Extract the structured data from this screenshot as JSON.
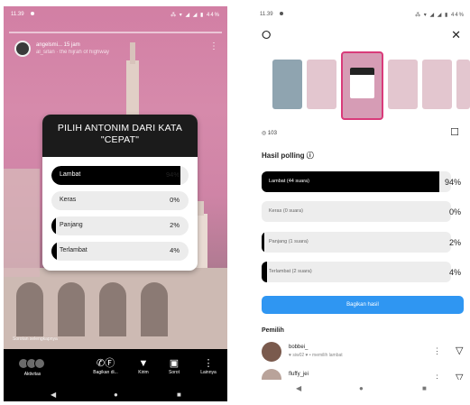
{
  "left": {
    "status": {
      "time": "11.39",
      "right": "⁂ ▾ ◢ ◢ ▮ 44%"
    },
    "author": {
      "name": "angelsmi...  15 jam",
      "sub": "al_sifan  ·  the hijrah of highway"
    },
    "poll": {
      "question": "PILIH ANTONIM DARI KATA \"CEPAT\"",
      "options": [
        {
          "label": "Lambat",
          "percent": "94%",
          "value": 94
        },
        {
          "label": "Keras",
          "percent": "0%",
          "value": 0
        },
        {
          "label": "Panjang",
          "percent": "2%",
          "value": 2
        },
        {
          "label": "Terlambat",
          "percent": "4%",
          "value": 4
        }
      ]
    },
    "footer_note": "Sorotan  selengkapnya",
    "bar": [
      {
        "label": "Aktivitas",
        "icon": "viewers-avatars"
      },
      {
        "label": "Bagikan di...",
        "icon": "whatsapp-facebook-icon"
      },
      {
        "label": "Kirim",
        "icon": "send-icon"
      },
      {
        "label": "Sorot",
        "icon": "highlight-icon"
      },
      {
        "label": "Lainnya",
        "icon": "more-icon"
      }
    ],
    "nav": {
      "back": "◀",
      "home": "●",
      "recent": "■"
    }
  },
  "right": {
    "status": {
      "time": "11.39",
      "right": "⁂ ▾ ◢ ◢ ▮ 44%"
    },
    "settings_icon": "⭘",
    "close_icon": "✕",
    "viewers": "◎ 103",
    "trash_icon": "☐",
    "results_title": "Hasil polling  ⓘ",
    "options": [
      {
        "label": "Lambat (44 suara)",
        "percent": "94%",
        "value": 94
      },
      {
        "label": "Keras (0 suara)",
        "percent": "0%",
        "value": 0
      },
      {
        "label": "Panjang (1 suara)",
        "percent": "2%",
        "value": 2
      },
      {
        "label": "Terlambat (2 suara)",
        "percent": "4%",
        "value": 4
      }
    ],
    "share_label": "Bagikan hasil",
    "voters_title": "Pemilih",
    "voters": [
      {
        "name": "bobbei_",
        "sub": "♥ siw02 ♥ • memilih lambat"
      },
      {
        "name": "fluffy_jei",
        "sub": ""
      }
    ],
    "nav": {
      "back": "◀",
      "home": "●",
      "recent": "■"
    }
  },
  "colors": {
    "accent_blue": "#2f96f2",
    "poll_fill": "#000000",
    "story_pink": "#d68aab",
    "selected_border": "#d93b7a"
  }
}
